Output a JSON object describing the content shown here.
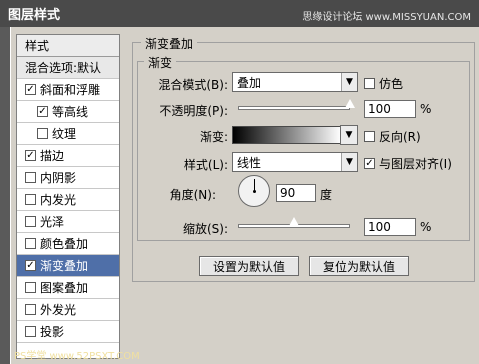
{
  "window": {
    "title": "图层样式",
    "watermark": "思缘设计论坛  www.MISSYUAN.COM"
  },
  "style_list": {
    "header": "样式",
    "blend_options": "混合选项:默认",
    "items": [
      {
        "label": "斜面和浮雕",
        "checked": true,
        "sub": false,
        "selected": false
      },
      {
        "label": "等高线",
        "checked": true,
        "sub": true,
        "selected": false
      },
      {
        "label": "纹理",
        "checked": false,
        "sub": true,
        "selected": false
      },
      {
        "label": "描边",
        "checked": true,
        "sub": false,
        "selected": false
      },
      {
        "label": "内阴影",
        "checked": false,
        "sub": false,
        "selected": false
      },
      {
        "label": "内发光",
        "checked": false,
        "sub": false,
        "selected": false
      },
      {
        "label": "光泽",
        "checked": false,
        "sub": false,
        "selected": false
      },
      {
        "label": "颜色叠加",
        "checked": false,
        "sub": false,
        "selected": false
      },
      {
        "label": "渐变叠加",
        "checked": true,
        "sub": false,
        "selected": true
      },
      {
        "label": "图案叠加",
        "checked": false,
        "sub": false,
        "selected": false
      },
      {
        "label": "外发光",
        "checked": false,
        "sub": false,
        "selected": false
      },
      {
        "label": "投影",
        "checked": false,
        "sub": false,
        "selected": false
      }
    ]
  },
  "panel": {
    "group_title": "渐变叠加",
    "inner_title": "渐变",
    "blend_mode": {
      "label": "混合模式(B):",
      "value": "叠加"
    },
    "dither": {
      "label": "仿色",
      "checked": false
    },
    "opacity": {
      "label": "不透明度(P):",
      "value": "100",
      "unit": "%",
      "level": 100
    },
    "gradient": {
      "label": "渐变:"
    },
    "reverse": {
      "label": "反向(R)",
      "checked": false
    },
    "style": {
      "label": "样式(L):",
      "value": "线性"
    },
    "align": {
      "label": "与图层对齐(I)",
      "checked": true
    },
    "angle": {
      "label": "角度(N):",
      "value": "90",
      "unit": "度"
    },
    "scale": {
      "label": "缩放(S):",
      "value": "100",
      "unit": "%",
      "level": 50
    },
    "buttons": {
      "set_default": "设置为默认值",
      "reset_default": "复位为默认值"
    }
  },
  "footer_watermark": "PS学堂 www.52PSXT.COM"
}
